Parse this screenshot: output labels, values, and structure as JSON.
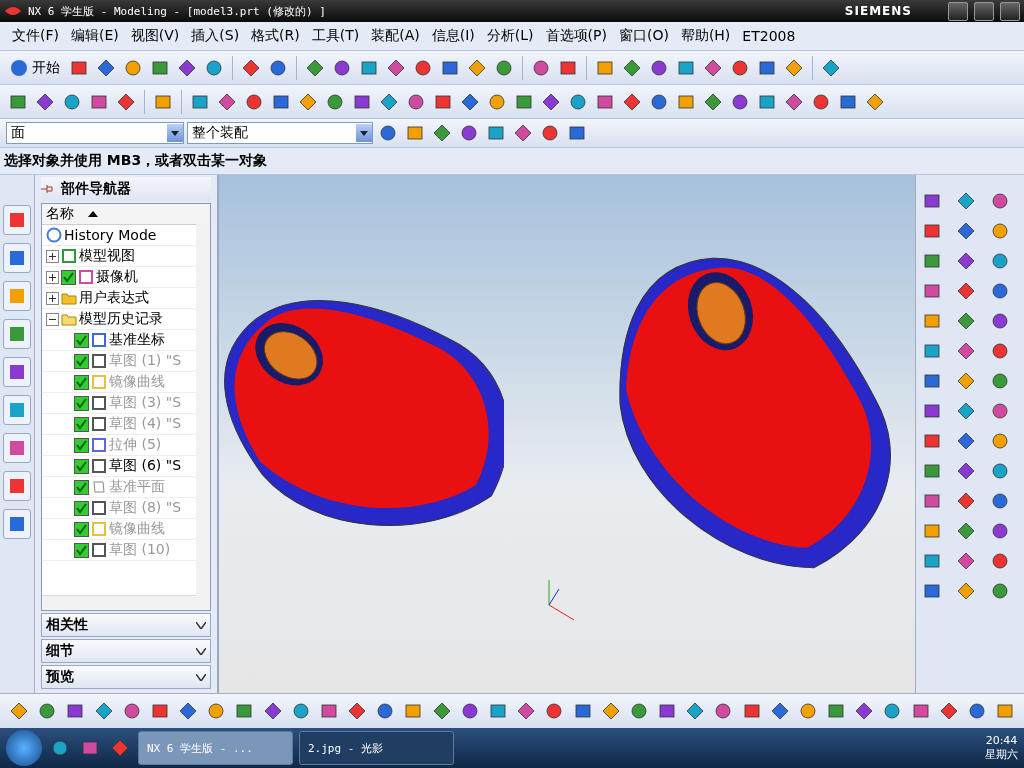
{
  "window": {
    "title": "NX 6 学生版 - Modeling - [model3.prt (修改的) ]",
    "brand": "SIEMENS"
  },
  "menu": [
    "文件(F)",
    "编辑(E)",
    "视图(V)",
    "插入(S)",
    "格式(R)",
    "工具(T)",
    "装配(A)",
    "信息(I)",
    "分析(L)",
    "首选项(P)",
    "窗口(O)",
    "帮助(H)",
    "ET2008"
  ],
  "start_button": "开始",
  "filters": [
    {
      "value": "面"
    },
    {
      "value": "整个装配"
    }
  ],
  "prompt": "选择对象并使用 MB3，或者双击某一对象",
  "navigator": {
    "title": "部件导航器",
    "column": "名称",
    "items": [
      {
        "label": "History Mode",
        "kind": "clock"
      },
      {
        "label": "模型视图",
        "kind": "views",
        "expanded": false
      },
      {
        "label": "摄像机",
        "kind": "camera",
        "expanded": false,
        "checked": true
      },
      {
        "label": "用户表达式",
        "kind": "open-folder",
        "expanded": false
      },
      {
        "label": "模型历史记录",
        "kind": "folder",
        "expanded": true,
        "children": [
          {
            "label": "基准坐标",
            "kind": "csys",
            "checked": true,
            "active": true
          },
          {
            "label": "草图 (1) \"S",
            "kind": "sketch",
            "checked": true,
            "active": false
          },
          {
            "label": "镜像曲线",
            "kind": "mirror",
            "checked": true,
            "active": false
          },
          {
            "label": "草图 (3) \"S",
            "kind": "sketch",
            "checked": true,
            "active": false
          },
          {
            "label": "草图 (4) \"S",
            "kind": "sketch",
            "checked": true,
            "active": false
          },
          {
            "label": "拉伸 (5)",
            "kind": "extrude",
            "checked": true,
            "active": false
          },
          {
            "label": "草图 (6) \"S",
            "kind": "sketch",
            "checked": true,
            "active": true
          },
          {
            "label": "基准平面",
            "kind": "plane",
            "checked": true,
            "active": false
          },
          {
            "label": "草图 (8) \"S",
            "kind": "sketch",
            "checked": true,
            "active": false
          },
          {
            "label": "镜像曲线",
            "kind": "mirror",
            "checked": true,
            "active": false
          },
          {
            "label": "草图 (10)",
            "kind": "sketch",
            "checked": true,
            "active": false
          }
        ]
      }
    ],
    "panels": [
      {
        "label": "相关性",
        "expanded": false
      },
      {
        "label": "细节",
        "expanded": false
      },
      {
        "label": "预览",
        "expanded": false
      }
    ]
  },
  "taskbar": {
    "windows": [
      {
        "label": "NX 6 学生版 - ...",
        "selected": true
      },
      {
        "label": "2.jpg - 光影",
        "selected": false
      }
    ],
    "time": "20:44",
    "day": "星期六"
  }
}
